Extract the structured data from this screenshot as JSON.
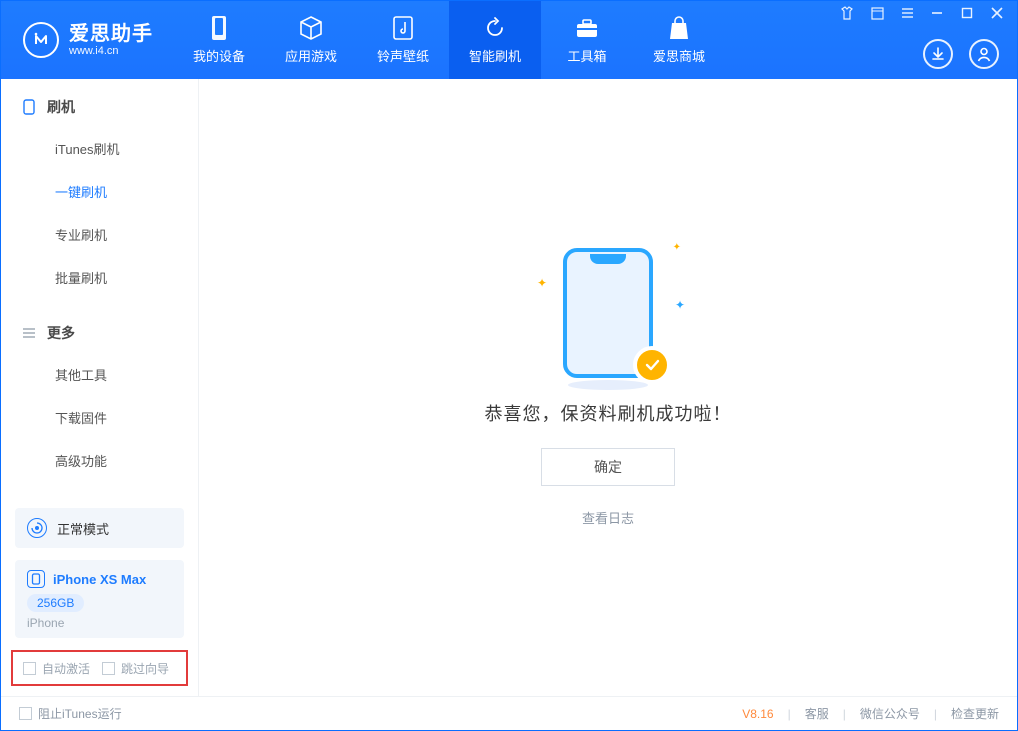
{
  "app": {
    "title_cn": "爱思助手",
    "url": "www.i4.cn"
  },
  "tabs": [
    {
      "label": "我的设备",
      "icon": "phone-icon"
    },
    {
      "label": "应用游戏",
      "icon": "cube-icon"
    },
    {
      "label": "铃声壁纸",
      "icon": "music-icon"
    },
    {
      "label": "智能刷机",
      "icon": "sync-icon",
      "active": true
    },
    {
      "label": "工具箱",
      "icon": "toolbox-icon"
    },
    {
      "label": "爱思商城",
      "icon": "bag-icon"
    }
  ],
  "window_controls": [
    "shirt-icon",
    "window-icon",
    "menu-icon",
    "minimize-icon",
    "maximize-icon",
    "close-icon"
  ],
  "header_actions": {
    "download_icon": "download-icon",
    "user_icon": "user-icon"
  },
  "sidebar": {
    "section1": {
      "title": "刷机",
      "icon": "device-small-icon",
      "items": [
        "iTunes刷机",
        "一键刷机",
        "专业刷机",
        "批量刷机"
      ],
      "active_index": 1
    },
    "section2": {
      "title": "更多",
      "icon": "list-icon",
      "items": [
        "其他工具",
        "下载固件",
        "高级功能"
      ]
    },
    "mode": {
      "icon": "recovery-icon",
      "text": "正常模式"
    },
    "device": {
      "icon": "phone-small-icon",
      "name": "iPhone XS Max",
      "capacity": "256GB",
      "type": "iPhone"
    },
    "checks": {
      "auto_activate": "自动激活",
      "skip_guide": "跳过向导"
    }
  },
  "main": {
    "success_text": "恭喜您，保资料刷机成功啦！",
    "ok_button": "确定",
    "log_link": "查看日志"
  },
  "statusbar": {
    "block_itunes": "阻止iTunes运行",
    "version": "V8.16",
    "links": [
      "客服",
      "微信公众号",
      "检查更新"
    ]
  },
  "colors": {
    "primary": "#1e7cff",
    "accent": "#ffb400",
    "highlight_border": "#e23b3b"
  }
}
